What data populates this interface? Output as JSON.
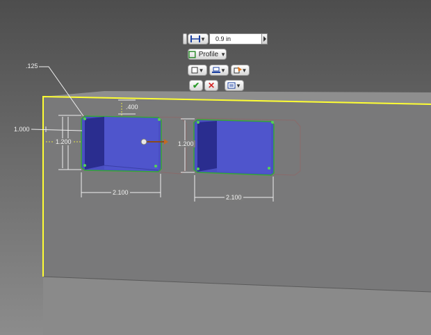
{
  "toolbar": {
    "distance_value": "0.9 in",
    "profile_label": "Profile",
    "icons": [
      "extent-distance-icon",
      "profile-select-icon",
      "output-solid-icon",
      "direction-icon",
      "operation-icon",
      "confirm-check-icon",
      "cancel-x-icon",
      "advanced-options-icon"
    ],
    "accent_confirm": "#2a9a2a",
    "accent_cancel": "#d22222"
  },
  "dimensions": {
    "fillet_radius": ".125",
    "top_offset": ".400",
    "left_offset": "1.000",
    "pocket1_height": "1.200",
    "pocket1_width": "2.100",
    "pocket2_height": "1.200",
    "pocket2_width": "2.100"
  },
  "colors": {
    "face": "#7a7a7b",
    "edge_highlight": "#ffff33",
    "pocket_fill": "#4a4fc2",
    "sketch_point": "#55d255"
  }
}
